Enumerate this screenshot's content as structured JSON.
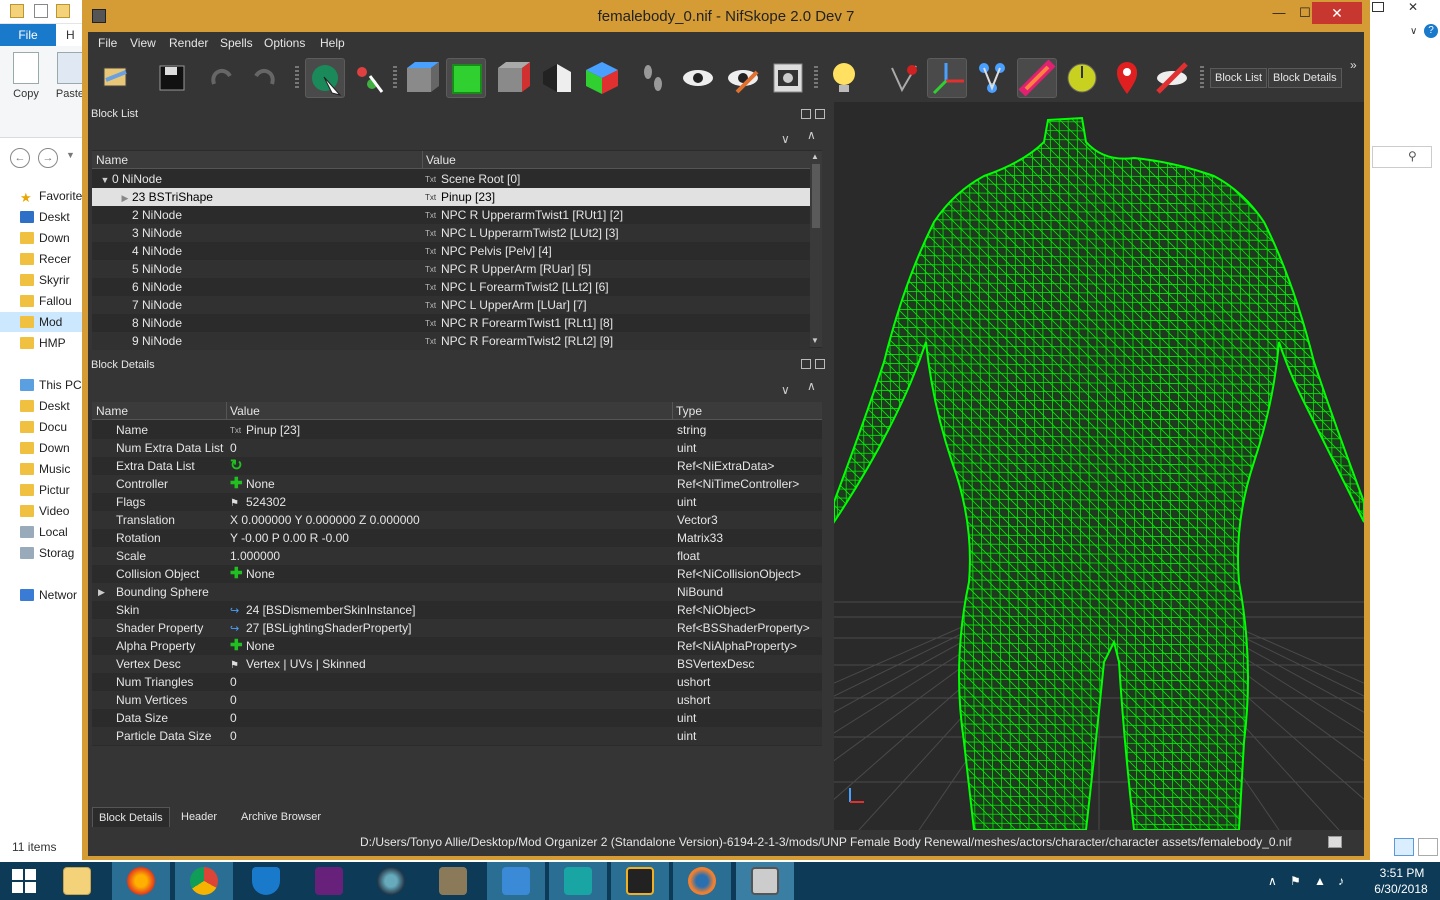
{
  "explorer": {
    "file_tab": "File",
    "home_tab": "H",
    "copy_label": "Copy",
    "paste_label": "Paste",
    "tree": [
      {
        "label": "Favorite",
        "icon": "star-icon"
      },
      {
        "label": "Deskt",
        "icon": "desktop-icon"
      },
      {
        "label": "Down",
        "icon": "folder-icon"
      },
      {
        "label": "Recer",
        "icon": "folder-icon"
      },
      {
        "label": "Skyrir",
        "icon": "folder-icon"
      },
      {
        "label": "Fallou",
        "icon": "folder-icon"
      },
      {
        "label": "Mod",
        "icon": "folder-icon"
      },
      {
        "label": "HMP",
        "icon": "folder-icon"
      },
      {
        "label": "This PC",
        "icon": "pc-icon"
      },
      {
        "label": "Deskt",
        "icon": "folder-icon"
      },
      {
        "label": "Docu",
        "icon": "folder-icon"
      },
      {
        "label": "Down",
        "icon": "folder-icon"
      },
      {
        "label": "Music",
        "icon": "folder-icon"
      },
      {
        "label": "Pictur",
        "icon": "folder-icon"
      },
      {
        "label": "Video",
        "icon": "folder-icon"
      },
      {
        "label": "Local",
        "icon": "drive-icon"
      },
      {
        "label": "Storag",
        "icon": "drive-icon"
      },
      {
        "label": "Networ",
        "icon": "network-icon"
      }
    ],
    "status": "11 items"
  },
  "nifskope": {
    "title": "femalebody_0.nif - NifSkope 2.0 Dev 7",
    "menu": [
      "File",
      "View",
      "Render",
      "Spells",
      "Options",
      "Help"
    ],
    "toolbar_text_buttons": [
      "Block List",
      "Block Details"
    ],
    "overflow": "»",
    "block_list": {
      "title": "Block List",
      "columns": [
        "Name",
        "Value"
      ],
      "rows": [
        {
          "name": "0 NiNode",
          "value": "Scene Root [0]",
          "expanded": true,
          "indent": 0
        },
        {
          "name": "23 BSTriShape",
          "value": "Pinup [23]",
          "selected": true,
          "indent": 1
        },
        {
          "name": "2 NiNode",
          "value": "NPC R UpperarmTwist1 [RUt1] [2]",
          "indent": 1
        },
        {
          "name": "3 NiNode",
          "value": "NPC L UpperarmTwist2 [LUt2] [3]",
          "indent": 1
        },
        {
          "name": "4 NiNode",
          "value": "NPC Pelvis [Pelv] [4]",
          "indent": 1
        },
        {
          "name": "5 NiNode",
          "value": "NPC R UpperArm [RUar] [5]",
          "indent": 1
        },
        {
          "name": "6 NiNode",
          "value": "NPC L ForearmTwist2 [LLt2] [6]",
          "indent": 1
        },
        {
          "name": "7 NiNode",
          "value": "NPC L UpperArm [LUar] [7]",
          "indent": 1
        },
        {
          "name": "8 NiNode",
          "value": "NPC R ForearmTwist1 [RLt1] [8]",
          "indent": 1
        },
        {
          "name": "9 NiNode",
          "value": "NPC R ForearmTwist2 [RLt2] [9]",
          "indent": 1
        }
      ]
    },
    "block_details": {
      "title": "Block Details",
      "columns": [
        "Name",
        "Value",
        "Type"
      ],
      "rows": [
        {
          "name": "Name",
          "value": "Pinup [23]",
          "type": "string",
          "icon": "txt"
        },
        {
          "name": "Num Extra Data List",
          "value": "0",
          "type": "uint",
          "icon": ""
        },
        {
          "name": "Extra Data List",
          "value": "",
          "type": "Ref<NiExtraData>",
          "icon": "refresh"
        },
        {
          "name": "Controller",
          "value": "None",
          "type": "Ref<NiTimeController>",
          "icon": "plus"
        },
        {
          "name": "Flags",
          "value": "524302",
          "type": "uint",
          "icon": "flag"
        },
        {
          "name": "Translation",
          "value": "X 0.000000 Y 0.000000 Z 0.000000",
          "type": "Vector3",
          "icon": ""
        },
        {
          "name": "Rotation",
          "value": "Y -0.00 P 0.00 R -0.00",
          "type": "Matrix33",
          "icon": ""
        },
        {
          "name": "Scale",
          "value": "1.000000",
          "type": "float",
          "icon": ""
        },
        {
          "name": "Collision Object",
          "value": "None",
          "type": "Ref<NiCollisionObject>",
          "icon": "plus"
        },
        {
          "name": "Bounding Sphere",
          "value": "",
          "type": "NiBound",
          "icon": "",
          "expandable": true
        },
        {
          "name": "Skin",
          "value": "24 [BSDismemberSkinInstance]",
          "type": "Ref<NiObject>",
          "icon": "link"
        },
        {
          "name": "Shader Property",
          "value": "27 [BSLightingShaderProperty]",
          "type": "Ref<BSShaderProperty>",
          "icon": "link"
        },
        {
          "name": "Alpha Property",
          "value": "None",
          "type": "Ref<NiAlphaProperty>",
          "icon": "plus"
        },
        {
          "name": "Vertex Desc",
          "value": "Vertex | UVs | Skinned",
          "type": "BSVertexDesc",
          "icon": "flag"
        },
        {
          "name": "Num Triangles",
          "value": "0",
          "type": "ushort",
          "icon": ""
        },
        {
          "name": "Num Vertices",
          "value": "0",
          "type": "ushort",
          "icon": ""
        },
        {
          "name": "Data Size",
          "value": "0",
          "type": "uint",
          "icon": ""
        },
        {
          "name": "Particle Data Size",
          "value": "0",
          "type": "uint",
          "icon": ""
        }
      ]
    },
    "bottom_tabs": [
      "Block Details",
      "Header",
      "Archive Browser"
    ],
    "status_path": "D:/Users/Tonyo Allie/Desktop/Mod Organizer 2 (Standalone Version)-6194-2-1-3/mods/UNP Female Body Renewal/meshes/actors/character/character assets/femalebody_0.nif",
    "wireframe_color": "#00ff00"
  },
  "taskbar": {
    "time": "3:51 PM",
    "date": "6/30/2018",
    "apps": [
      "file-explorer-icon",
      "firefox-icon",
      "chrome-icon",
      "defender-icon",
      "visual-studio-icon",
      "camera-icon",
      "gimp-icon",
      "app-icon",
      "3dsmax-icon",
      "app-icon",
      "blender-icon",
      "nifskope-icon"
    ]
  }
}
